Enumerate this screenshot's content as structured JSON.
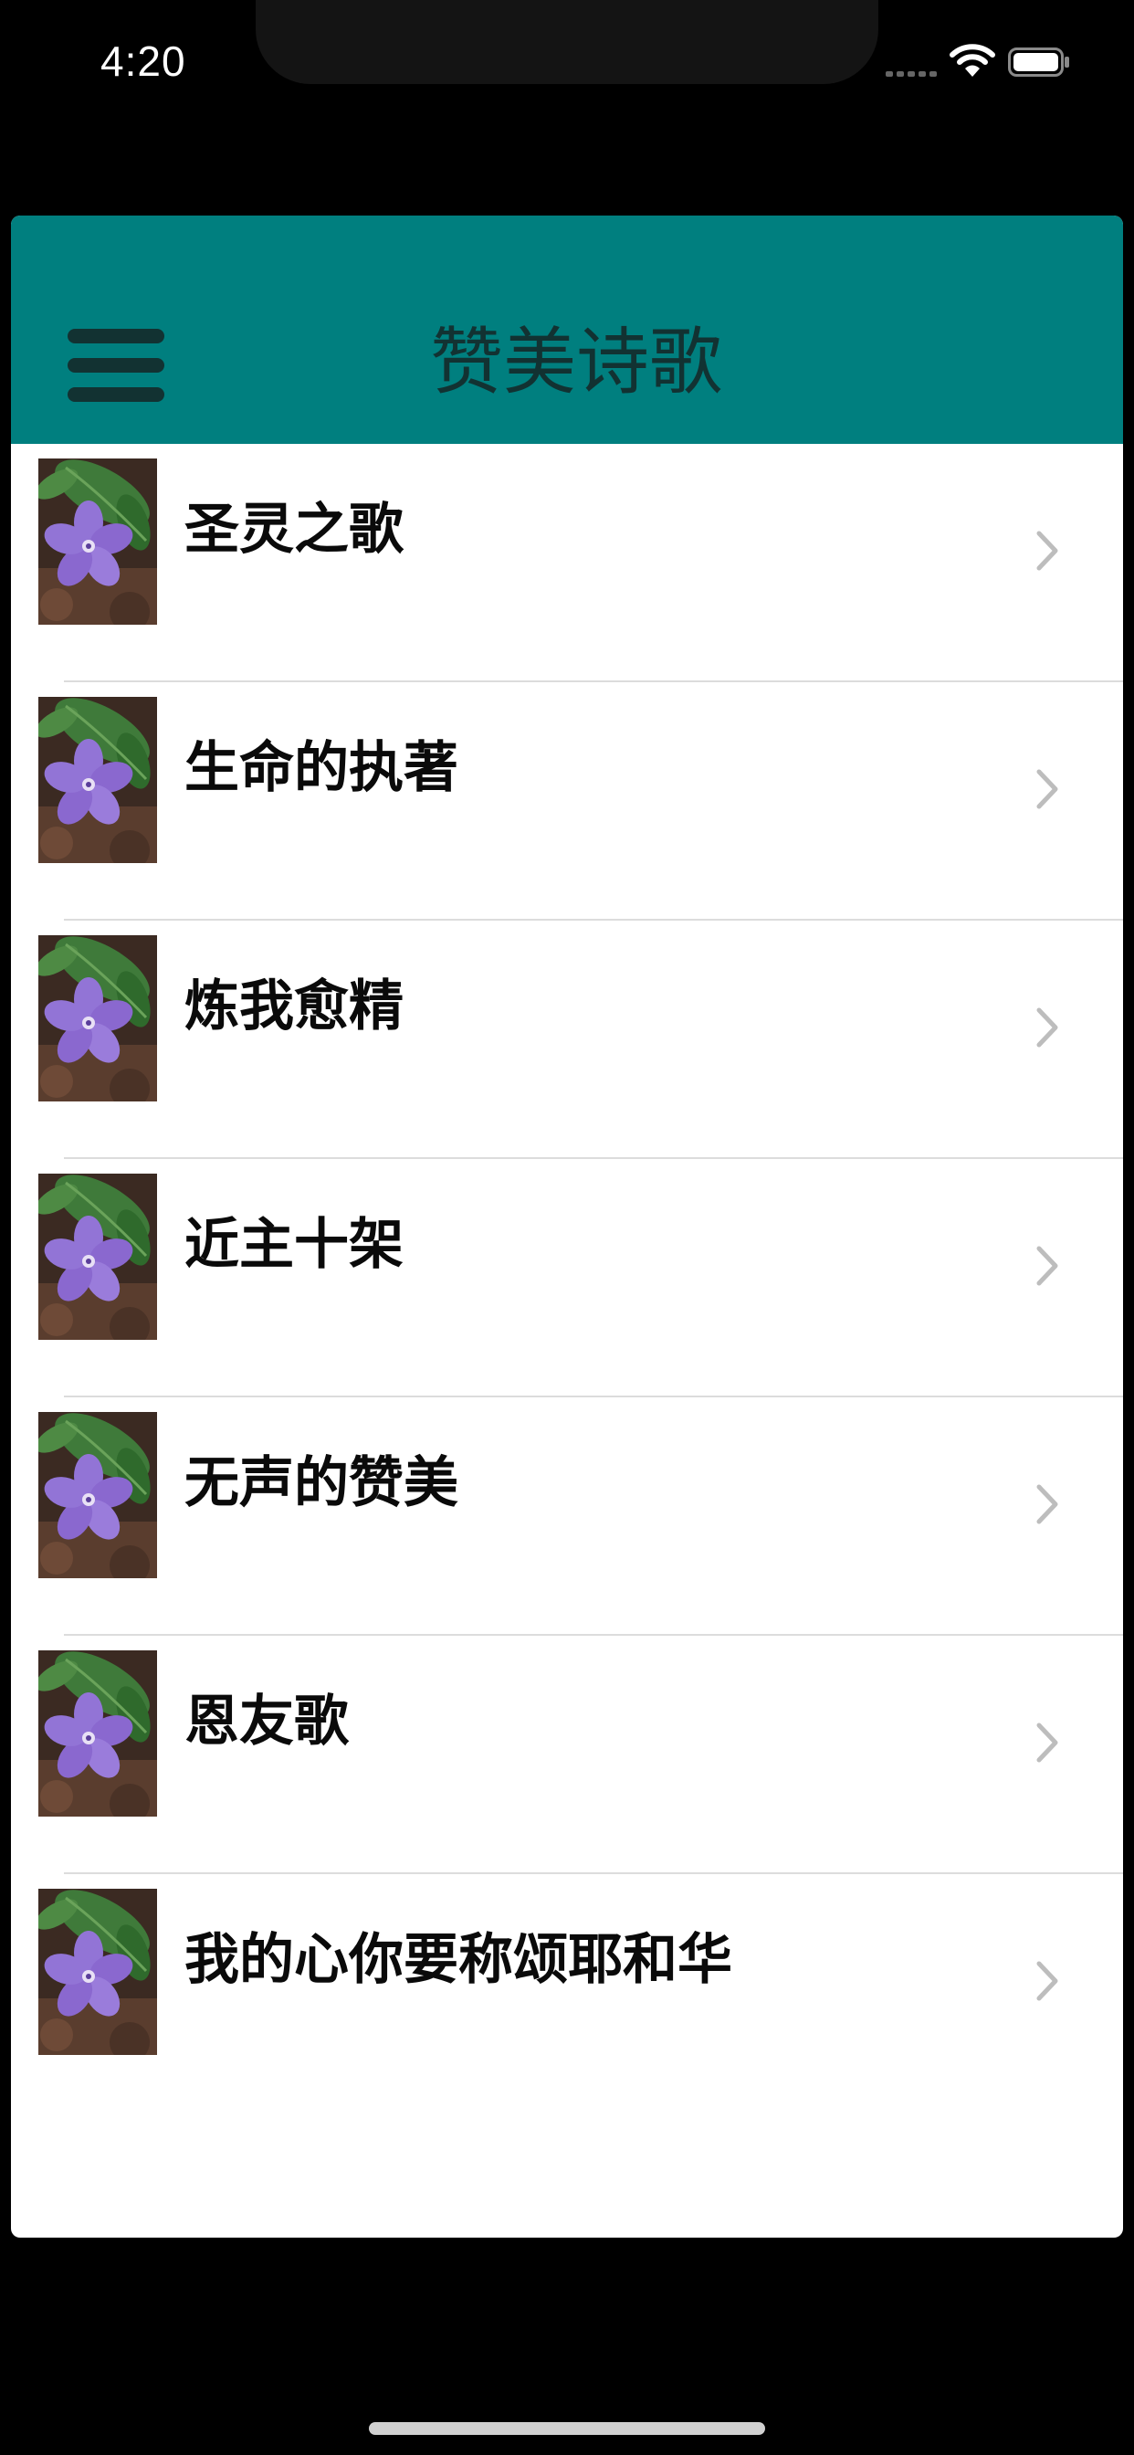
{
  "status_bar": {
    "time": "4:20",
    "icons": [
      "signal-icon",
      "wifi-icon",
      "battery-icon"
    ]
  },
  "header": {
    "title": "赞美诗歌",
    "menu_icon": "hamburger-menu-icon",
    "background_color": "#007f7f"
  },
  "list": {
    "items": [
      {
        "title": "圣灵之歌",
        "thumbnail": "periwinkle-flower-image"
      },
      {
        "title": "生命的执著",
        "thumbnail": "periwinkle-flower-image"
      },
      {
        "title": "炼我愈精",
        "thumbnail": "periwinkle-flower-image"
      },
      {
        "title": "近主十架",
        "thumbnail": "periwinkle-flower-image"
      },
      {
        "title": "无声的赞美",
        "thumbnail": "periwinkle-flower-image"
      },
      {
        "title": "恩友歌",
        "thumbnail": "periwinkle-flower-image"
      },
      {
        "title": "我的心你要称颂耶和华",
        "thumbnail": "periwinkle-flower-image"
      }
    ],
    "chevron_icon": "chevron-right-icon"
  }
}
